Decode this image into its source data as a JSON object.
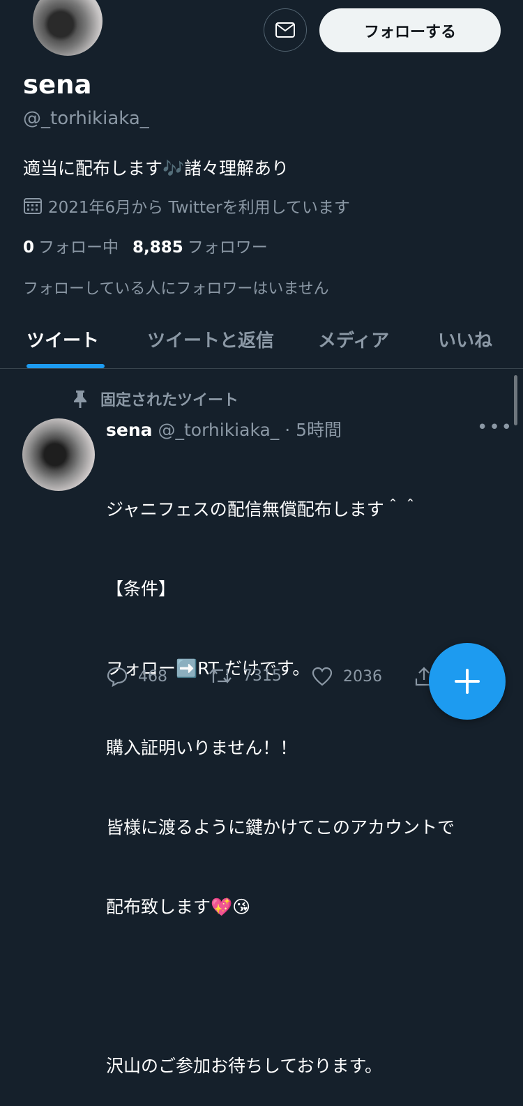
{
  "profile": {
    "name": "sena",
    "handle": "@_torhikiaka_",
    "bio": "適当に配布します🎶諸々理解あり",
    "joined": "2021年6月から Twitterを利用しています",
    "following_count": "0",
    "following_label": "フォロー中",
    "followers_count": "8,885",
    "followers_label": "フォロワー",
    "mutual_note": "フォローしている人にフォロワーはいません"
  },
  "header": {
    "follow_label": "フォローする"
  },
  "tabs": [
    {
      "label": "ツイート",
      "active": true
    },
    {
      "label": "ツイートと返信",
      "active": false
    },
    {
      "label": "メディア",
      "active": false
    },
    {
      "label": "いいね",
      "active": false
    }
  ],
  "tweet": {
    "pinned_label": "固定されたツイート",
    "name": "sena",
    "handle": "@_torhikiaka_",
    "separator": "·",
    "time": "5時間",
    "lines": [
      "ジャニフェスの配信無償配布します＾＾",
      "【条件】",
      "フォロー➡️RT だけです。",
      "購入証明いりません！！",
      "皆様に渡るように鍵かけてこのアカウントで",
      "配布致します💖😘",
      "",
      "沢山のご参加お待ちしております。"
    ],
    "reply_count": "468",
    "retweet_count": "7315",
    "like_count": "2036"
  },
  "colors": {
    "background": "#15202b",
    "accent": "#1d9bf0",
    "secondary_text": "#8b98a5"
  },
  "icons": [
    "mail-icon",
    "calendar-icon",
    "pin-icon",
    "more-icon",
    "reply-icon",
    "retweet-icon",
    "like-icon",
    "share-icon",
    "plus-icon"
  ]
}
